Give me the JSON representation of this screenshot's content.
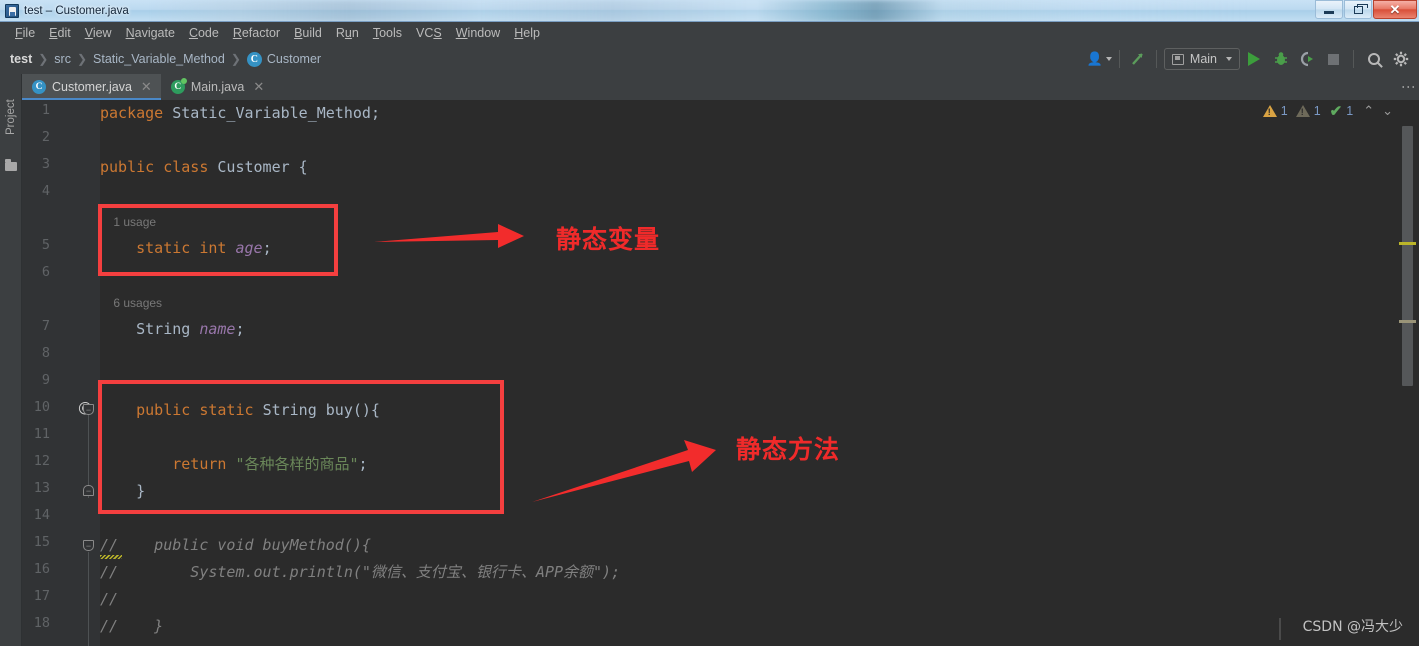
{
  "window": {
    "title": "test – Customer.java",
    "app_icon": "intellij-idea-icon",
    "buttons": {
      "minimize": "–",
      "restore": "❐",
      "close": "✕"
    }
  },
  "menubar": {
    "items": [
      {
        "label": "File",
        "mnemonic": "F"
      },
      {
        "label": "Edit",
        "mnemonic": "E"
      },
      {
        "label": "View",
        "mnemonic": "V"
      },
      {
        "label": "Navigate",
        "mnemonic": "N"
      },
      {
        "label": "Code",
        "mnemonic": "C"
      },
      {
        "label": "Refactor",
        "mnemonic": "R"
      },
      {
        "label": "Build",
        "mnemonic": "B"
      },
      {
        "label": "Run",
        "mnemonic": "u"
      },
      {
        "label": "Tools",
        "mnemonic": "T"
      },
      {
        "label": "VCS",
        "mnemonic": ""
      },
      {
        "label": "Window",
        "mnemonic": "W"
      },
      {
        "label": "Help",
        "mnemonic": "H"
      }
    ]
  },
  "breadcrumb": {
    "items": [
      "test",
      "src",
      "Static_Variable_Method",
      "Customer"
    ],
    "separator": "❯",
    "class_badge": "C"
  },
  "toolbar": {
    "account_icon": "people-icon",
    "build_icon": "build-hammer-icon",
    "run_config": {
      "label": "Main",
      "icon": "run-configuration-icon"
    },
    "run_icon": "run-play-icon",
    "debug_icon": "debug-bug-icon",
    "run_coverage_icon": "run-with-coverage-icon",
    "stop_icon": "stop-square-icon",
    "search_icon": "search-icon",
    "settings_icon": "gear-icon",
    "more_icon": "more-vertical-icon"
  },
  "left_strip": {
    "project_label": "Project",
    "folder_icon": "folder-icon"
  },
  "tabs": [
    {
      "label": "Customer.java",
      "icon": "java-class-icon",
      "active": true,
      "close": "✕"
    },
    {
      "label": "Main.java",
      "icon": "java-main-class-icon",
      "active": false,
      "close": "✕"
    }
  ],
  "inspections": {
    "warning_count": "1",
    "weak_warning_count": "1",
    "ok_count": "1",
    "up_chevron": "⌃",
    "down_chevron": "⌄"
  },
  "editor": {
    "line_numbers": [
      "1",
      "2",
      "3",
      "4",
      "5",
      "6",
      "7",
      "8",
      "9",
      "10",
      "11",
      "12",
      "13",
      "14",
      "15",
      "16",
      "17",
      "18"
    ],
    "lines": [
      {
        "n": 1,
        "tokens": [
          {
            "t": "package ",
            "c": "k"
          },
          {
            "t": "Static_Variable_Method",
            "c": "ty"
          },
          {
            "t": ";",
            "c": "punct"
          }
        ]
      },
      {
        "n": 2,
        "tokens": []
      },
      {
        "n": 3,
        "tokens": [
          {
            "t": "public ",
            "c": "k"
          },
          {
            "t": "class ",
            "c": "k"
          },
          {
            "t": "Customer",
            "c": "cls"
          },
          {
            "t": " {",
            "c": "brace"
          }
        ]
      },
      {
        "n": 4,
        "tokens": []
      },
      {
        "n": "hint1",
        "tokens": [
          {
            "t": "    1 usage",
            "c": "usage"
          }
        ]
      },
      {
        "n": 5,
        "tokens": [
          {
            "t": "    static ",
            "c": "k"
          },
          {
            "t": "int ",
            "c": "k"
          },
          {
            "t": "age",
            "c": "fld"
          },
          {
            "t": ";",
            "c": "punct"
          }
        ]
      },
      {
        "n": 6,
        "tokens": []
      },
      {
        "n": "hint2",
        "tokens": [
          {
            "t": "    6 usages",
            "c": "usage"
          }
        ]
      },
      {
        "n": 7,
        "tokens": [
          {
            "t": "    String ",
            "c": "ty"
          },
          {
            "t": "name",
            "c": "fld"
          },
          {
            "t": ";",
            "c": "punct"
          }
        ]
      },
      {
        "n": 8,
        "tokens": []
      },
      {
        "n": 9,
        "tokens": []
      },
      {
        "n": 10,
        "tokens": [
          {
            "t": "    public ",
            "c": "k"
          },
          {
            "t": "static ",
            "c": "k"
          },
          {
            "t": "String ",
            "c": "ty"
          },
          {
            "t": "buy",
            "c": "mth"
          },
          {
            "t": "(){",
            "c": "brace"
          }
        ]
      },
      {
        "n": 11,
        "tokens": []
      },
      {
        "n": 12,
        "tokens": [
          {
            "t": "        return ",
            "c": "k"
          },
          {
            "t": "\"各种各样的商品\"",
            "c": "str"
          },
          {
            "t": ";",
            "c": "punct"
          }
        ]
      },
      {
        "n": 13,
        "tokens": [
          {
            "t": "    }",
            "c": "brace"
          }
        ]
      },
      {
        "n": 14,
        "tokens": []
      },
      {
        "n": 15,
        "tokens": [
          {
            "t": "//    public void buyMethod(){",
            "c": "cmt"
          }
        ]
      },
      {
        "n": 16,
        "tokens": [
          {
            "t": "//        System.out.println(\"微信、支付宝、银行卡、APP余额\");",
            "c": "cmt"
          }
        ]
      },
      {
        "n": 17,
        "tokens": [
          {
            "t": "//",
            "c": "cmt"
          }
        ]
      },
      {
        "n": 18,
        "tokens": [
          {
            "t": "//    }",
            "c": "cmt"
          }
        ]
      }
    ],
    "gutter_markers": {
      "at_line": "10",
      "at_symbol": "@",
      "fold_open": "−",
      "fold_close": "−"
    }
  },
  "annotations": [
    {
      "label": "静态变量",
      "target": "static-variable-box"
    },
    {
      "label": "静态方法",
      "target": "static-method-box"
    }
  ],
  "colors": {
    "red_highlight": "#f43f3f",
    "annotation_text": "#f02a2a",
    "editor_bg": "#2b2b2b",
    "gutter_bg": "#313335",
    "chrome_bg": "#3c3f41",
    "keyword": "#cc7832",
    "string": "#6a8759",
    "field": "#9876aa",
    "comment": "#808080",
    "plain": "#a9b7c6",
    "tab_accent": "#4a88c7"
  },
  "watermark": {
    "text": "CSDN @冯大少"
  }
}
